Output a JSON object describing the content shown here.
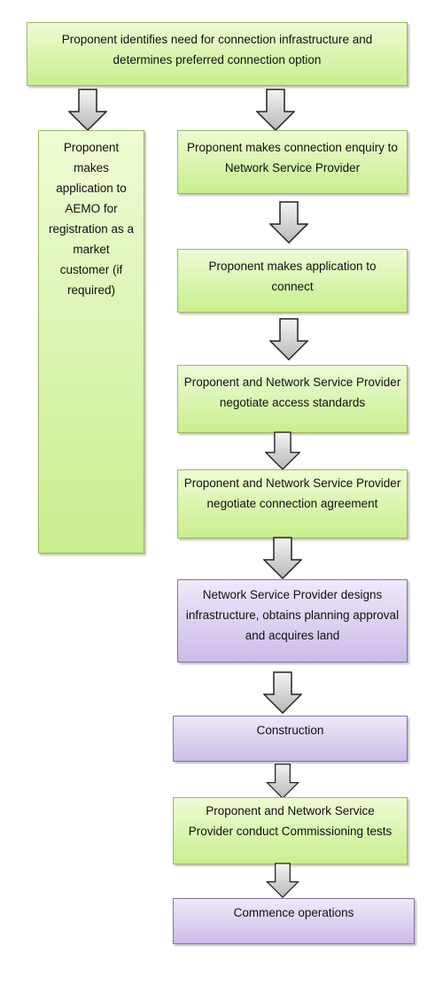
{
  "colors": {
    "green_fill": "#c9ee8e",
    "green_border": "#9bbb59",
    "purple_fill": "#cbbbe8",
    "purple_border": "#8a72ac",
    "arrow_fill": "#d0d0d0"
  },
  "steps": [
    {
      "text": "Proponent identifies need for connection infrastructure and determines preferred connection option",
      "color": "green"
    },
    {
      "text": "Proponent makes application to AEMO for registration as a market customer (if required)",
      "color": "green"
    },
    {
      "text": "Proponent makes connection enquiry to Network Service Provider",
      "color": "green"
    },
    {
      "text": "Proponent makes application to connect",
      "color": "green"
    },
    {
      "text": "Proponent and Network Service Provider negotiate access standards",
      "color": "green"
    },
    {
      "text": "Proponent and Network Service Provider negotiate connection agreement",
      "color": "green"
    },
    {
      "text": "Network Service Provider designs infrastructure, obtains planning approval and acquires land",
      "color": "purple"
    },
    {
      "text": "Construction",
      "color": "purple"
    },
    {
      "text": "Proponent and Network Service Provider conduct Commissioning tests",
      "color": "green"
    },
    {
      "text": "Commence operations",
      "color": "purple"
    }
  ]
}
